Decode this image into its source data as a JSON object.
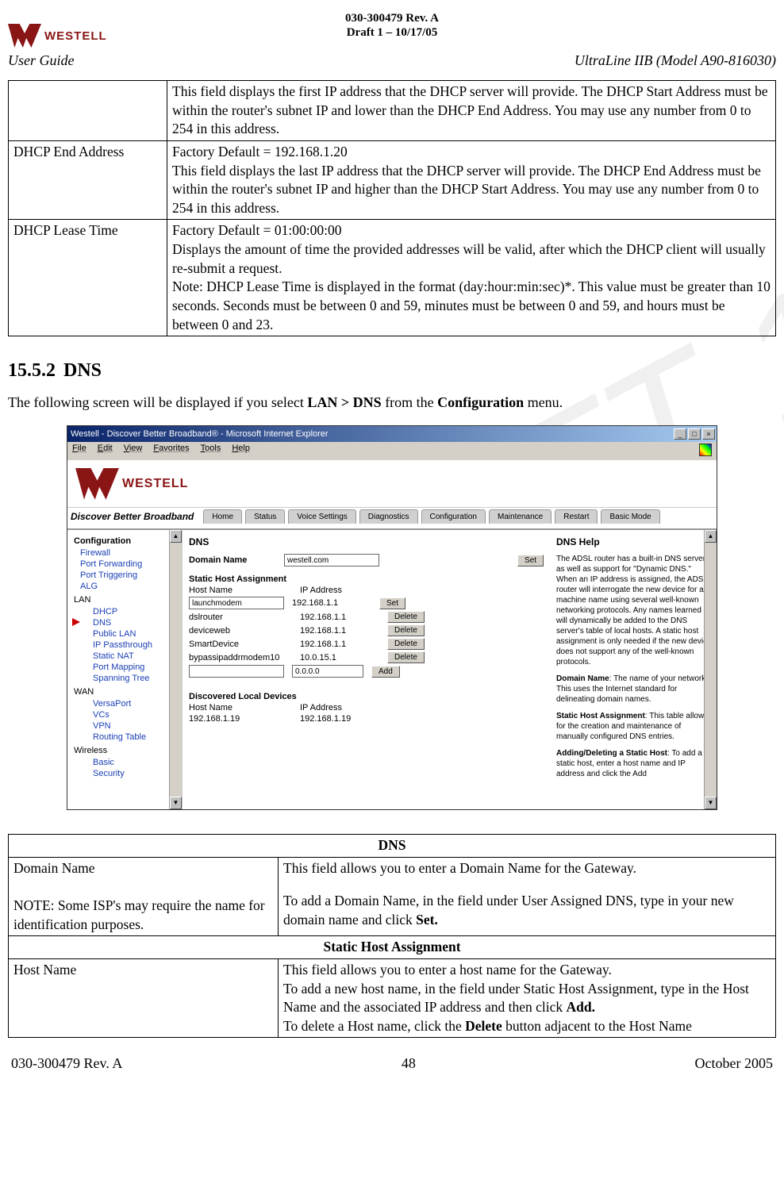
{
  "doc_header": {
    "doc_id": "030-300479 Rev. A",
    "draft_line": "Draft 1 – 10/17/05",
    "user_guide": "User Guide",
    "model": "UltraLine IIB (Model A90-816030)",
    "logo_text": "WESTELL"
  },
  "param_table": {
    "row1_label": "",
    "row1_desc": "This field displays the first IP address that the DHCP server will provide. The DHCP Start Address must be within the router's subnet IP and lower than the DHCP End Address. You may use any number from 0 to 254 in this address.",
    "row2_label": "DHCP End Address",
    "row2_desc": "Factory Default = 192.168.1.20\nThis field displays the last IP address that the DHCP server will provide. The DHCP End Address must be within the router's subnet IP and higher than the DHCP Start Address. You may use any number from 0 to 254 in this address.",
    "row3_label": "DHCP Lease Time",
    "row3_desc": "Factory Default = 01:00:00:00\nDisplays the amount of time the provided addresses will be valid, after which the DHCP client will usually re-submit a request.\nNote: DHCP Lease Time is displayed in the format (day:hour:min:sec)*. This value must be greater than 10 seconds. Seconds must be between 0 and 59, minutes must be between 0 and 59, and hours must be between 0 and 23."
  },
  "section": {
    "num": "15.5.2",
    "title": "DNS"
  },
  "intro": {
    "pre": "The following screen will be displayed if you select ",
    "b1": "LAN > DNS",
    "mid": " from the ",
    "b2": "Configuration",
    "post": " menu."
  },
  "browser": {
    "title": "Westell - Discover Better Broadband® - Microsoft Internet Explorer",
    "menus": [
      "File",
      "Edit",
      "View",
      "Favorites",
      "Tools",
      "Help"
    ],
    "logo_text": "WESTELL",
    "slogan": "Discover Better Broadband",
    "tabs": [
      "Home",
      "Status",
      "Voice Settings",
      "Diagnostics",
      "Configuration",
      "Maintenance",
      "Restart",
      "Basic Mode"
    ]
  },
  "sidebar": {
    "heading": "Configuration",
    "items1": [
      "Firewall",
      "Port Forwarding",
      "Port Triggering",
      "ALG"
    ],
    "lan_label": "LAN",
    "lan_items": [
      "DHCP",
      "DNS",
      "Public LAN",
      "IP Passthrough",
      "Static NAT",
      "Port Mapping",
      "Spanning Tree"
    ],
    "wan_label": "WAN",
    "wan_items": [
      "VersaPort",
      "VCs",
      "VPN",
      "Routing Table"
    ],
    "wireless_label": "Wireless",
    "wireless_items": [
      "Basic",
      "Security"
    ]
  },
  "dns_panel": {
    "heading": "DNS",
    "domain_label": "Domain Name",
    "domain_value": "westell.com",
    "set_btn": "Set",
    "static_heading": "Static Host Assignment",
    "col_host": "Host Name",
    "col_ip": "IP Address",
    "rows": [
      {
        "host": "launchmodem",
        "ip": "192.168.1.1",
        "btn": "Set"
      },
      {
        "host": "dslrouter",
        "ip": "192.168.1.1",
        "btn": "Delete"
      },
      {
        "host": "deviceweb",
        "ip": "192.168.1.1",
        "btn": "Delete"
      },
      {
        "host": "SmartDevice",
        "ip": "192.168.1.1",
        "btn": "Delete"
      },
      {
        "host": "bypassipaddrmodem10",
        "ip": "10.0.15.1",
        "btn": "Delete"
      },
      {
        "host": "",
        "ip": "0.0.0.0",
        "btn": "Add"
      }
    ],
    "discovered_heading": "Discovered Local Devices",
    "disc_host": "Host Name",
    "disc_ip": "IP Address",
    "disc_row": {
      "host": "192.168.1.19",
      "ip": "192.168.1.19"
    }
  },
  "help_panel": {
    "heading": "DNS Help",
    "p1": "The ADSL router has a built-in DNS server, as well as support for \"Dynamic DNS.\" When an IP address is assigned, the ADSL router will interrogate the new device for a machine name using several well-known networking protocols. Any names learned will dynamically be added to the DNS server's table of local hosts. A static host assignment is only needed if the new device does not support any of the well-known protocols.",
    "dn_b": "Domain Name",
    "dn_t": ": The name of your network. This uses the Internet standard for delineating domain names.",
    "sha_b": "Static Host Assignment",
    "sha_t": ": This table allows for the creation and maintenance of manually configured DNS entries.",
    "ad_b": "Adding/Deleting a Static Host",
    "ad_t": ": To add a static host, enter a host name and IP address and click the Add"
  },
  "dns_table": {
    "hdr1": "DNS",
    "domain_left": "Domain Name\n\nNOTE: Some ISP's may require the name for identification purposes.",
    "domain_right_l1": "This field allows you to enter a Domain Name for the Gateway.",
    "domain_right_l2a": "To add a Domain Name, in the field under User Assigned DNS, type in your new domain name and click ",
    "domain_right_l2b": "Set.",
    "hdr2": "Static Host Assignment",
    "host_left": "Host Name",
    "host_right_l1": "This field allows you to enter a host name for the Gateway.",
    "host_right_l2a": "To add a new host name, in the field under Static Host Assignment, type in the Host Name and the associated IP address and then click ",
    "host_right_l2b": "Add.",
    "host_right_l3a": "To delete a Host name, click the ",
    "host_right_l3b": "Delete",
    "host_right_l3c": " button adjacent to the Host Name"
  },
  "footer": {
    "left": "030-300479 Rev. A",
    "center": "48",
    "right": "October 2005"
  }
}
